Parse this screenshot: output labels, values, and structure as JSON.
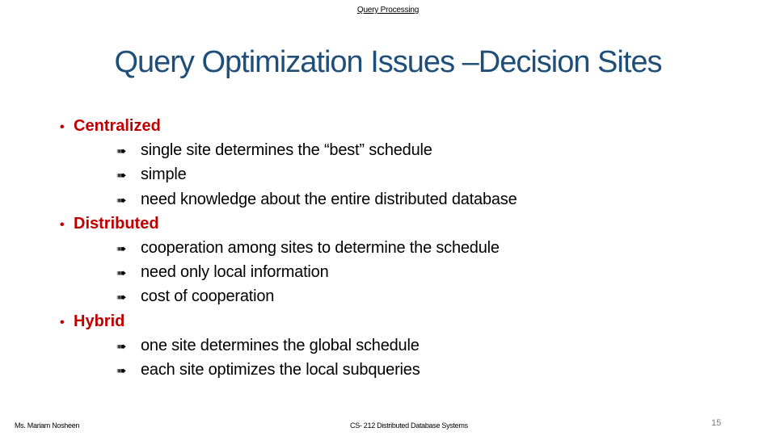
{
  "header": {
    "section": "Query Processing"
  },
  "slide": {
    "title": "Query Optimization Issues –Decision Sites",
    "bullet_icon": "bullet-dot",
    "sub_icon": "heavy-right-arrow",
    "bullet_glyph": "•",
    "arrow_glyph": "➠",
    "colors": {
      "title": "#1f4e79",
      "bullet": "#c00000",
      "text": "#000000"
    },
    "sections": [
      {
        "heading": "Centralized",
        "items": [
          "single site determines the “best” schedule",
          "simple",
          "need knowledge about the entire distributed database"
        ]
      },
      {
        "heading": "Distributed",
        "items": [
          "cooperation among sites to determine the schedule",
          "need only local information",
          "cost of cooperation"
        ]
      },
      {
        "heading": "Hybrid",
        "items": [
          "one site determines the global schedule",
          "each site optimizes the local subqueries"
        ]
      }
    ]
  },
  "footer": {
    "author": "Ms. Mariam Nosheen",
    "course": "CS- 212 Distributed Database Systems",
    "page_number": "15"
  }
}
